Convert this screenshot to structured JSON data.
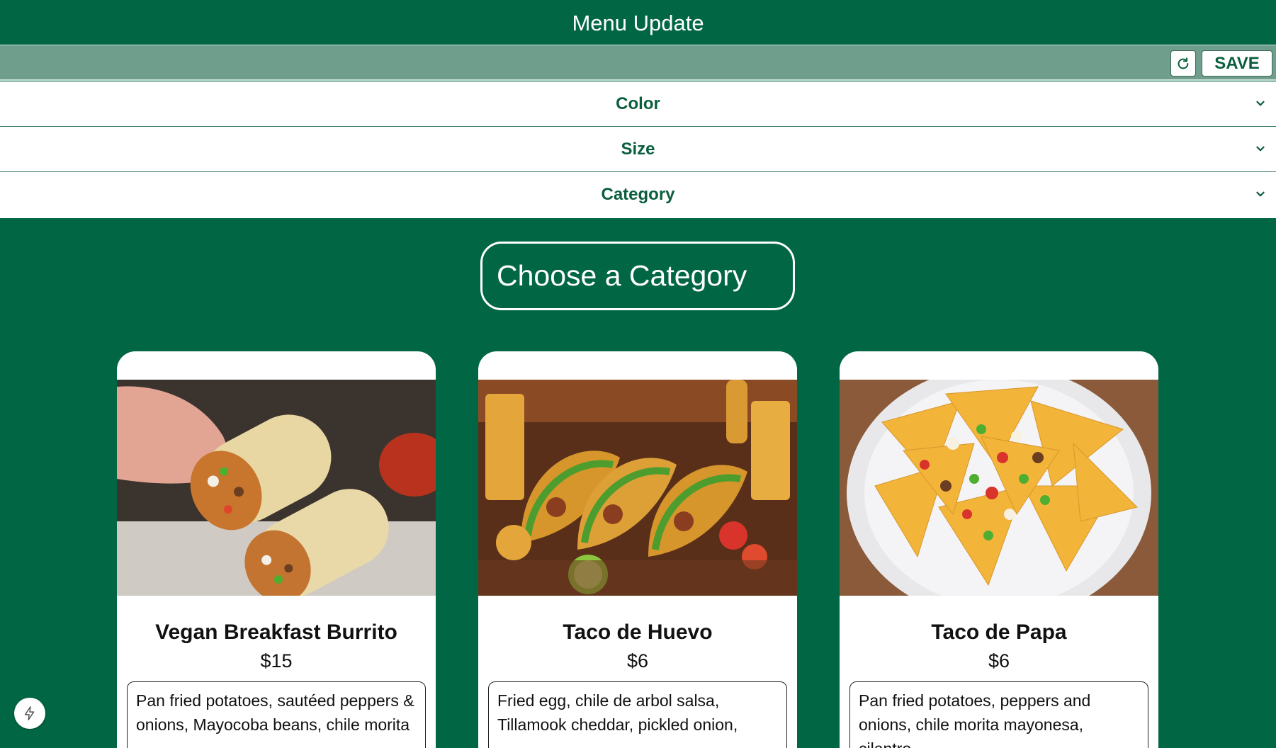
{
  "header": {
    "title": "Menu Update"
  },
  "toolbar": {
    "refresh_icon": "refresh-icon",
    "save_label": "SAVE"
  },
  "filters": [
    {
      "label": "Color",
      "icon": "chevron-down-icon"
    },
    {
      "label": "Size",
      "icon": "chevron-down-icon"
    },
    {
      "label": "Category",
      "icon": "chevron-down-icon"
    }
  ],
  "category_button": {
    "label": "Choose a Category"
  },
  "menu_items": [
    {
      "name": "Vegan Breakfast Burrito",
      "price": "$15",
      "description": "Pan fried potatoes, sautéed peppers & onions, Mayocoba beans, chile morita"
    },
    {
      "name": "Taco de Huevo",
      "price": "$6",
      "description": "Fried egg, chile de arbol salsa, Tillamook cheddar, pickled onion,"
    },
    {
      "name": "Taco de Papa",
      "price": "$6",
      "description": "Pan fried potatoes, peppers and onions, chile morita mayonesa, cilantro"
    }
  ],
  "floating_action": {
    "icon": "lightning-bolt-icon"
  },
  "colors": {
    "brand_green": "#016644",
    "toolbar_green": "#6f9f8c",
    "text_green": "#0b5e3d"
  }
}
